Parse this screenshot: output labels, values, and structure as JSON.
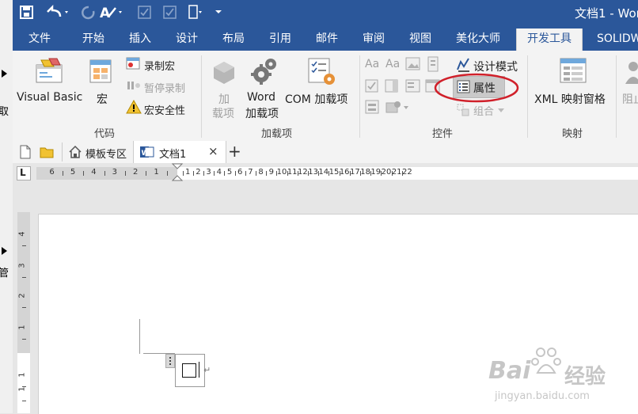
{
  "titlebar": {
    "title": "文档1 - Wor"
  },
  "tabs": [
    "文件",
    "开始",
    "插入",
    "设计",
    "布局",
    "引用",
    "邮件",
    "审阅",
    "视图",
    "美化大师",
    "开发工具",
    "SOLIDW"
  ],
  "behind_window": {
    "char1": "取",
    "char2": "管"
  },
  "ribbon": {
    "code_group": {
      "label": "代码",
      "visual_basic": "Visual Basic",
      "macro": "宏",
      "record_macro": "录制宏",
      "pause_record": "暂停录制",
      "macro_security": "宏安全性"
    },
    "addins_group": {
      "label": "加载项",
      "addins_line1": "加",
      "addins_line2": "载项",
      "word_addins_line1": "Word",
      "word_addins_line2": "加载项",
      "com_addins": "COM 加载项"
    },
    "controls_group": {
      "label": "控件",
      "design_mode": "设计模式",
      "properties": "属性",
      "group": "组合",
      "aa1": "Aa",
      "aa2": "Aa"
    },
    "mapping_group": {
      "label": "映射",
      "xml_pane": "XML 映射窗格"
    },
    "protect_group": {
      "block": "阻止"
    }
  },
  "doc_tabs": {
    "templates": "模板专区",
    "document": "文档1",
    "close": "×",
    "add": "+"
  },
  "ruler": {
    "left_numbers": [
      "6",
      "5",
      "4",
      "3",
      "2",
      "1"
    ],
    "right_numbers": [
      "2",
      "4",
      "6",
      "8",
      "10",
      "12",
      "14",
      "16",
      "18",
      "20",
      "22"
    ],
    "odd_numbers": [
      "1",
      "3",
      "5",
      "7",
      "9",
      "11",
      "13",
      "15",
      "17",
      "19",
      "21"
    ],
    "vertical_numbers": [
      "4",
      "3",
      "2",
      "1",
      "1",
      "1"
    ],
    "tab_stop_glyph": "L"
  },
  "watermark": {
    "brand": "Bai",
    "brand2": "经验",
    "url": "jingyan.baidu.com"
  },
  "colors": {
    "accent": "#2b579a",
    "highlight_ring": "#d0202a"
  }
}
